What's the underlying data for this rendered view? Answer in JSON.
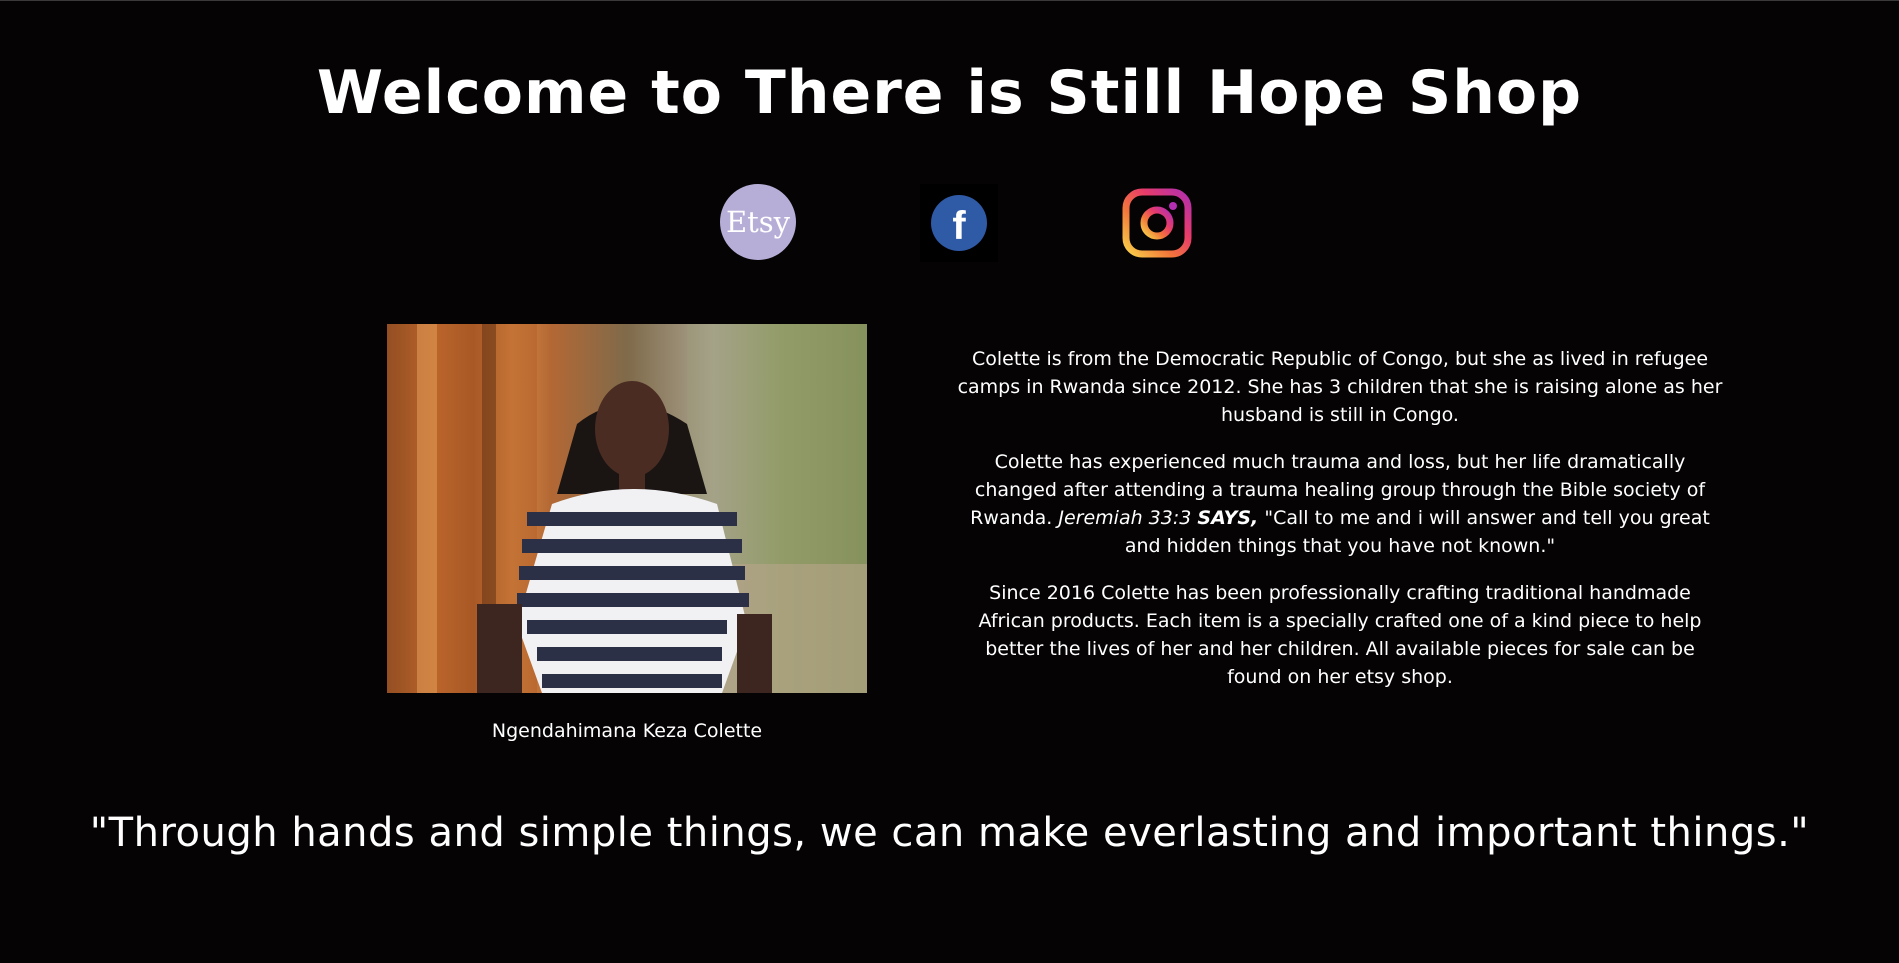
{
  "header": {
    "title": "Welcome to There is Still Hope Shop"
  },
  "social": {
    "etsy": {
      "label": "Etsy",
      "color": "#b7aed8"
    },
    "facebook": {
      "label": "f",
      "color": "#2f5aa6"
    },
    "instagram": {
      "gradient": [
        "#f9d24a",
        "#f2773a",
        "#e83c6a",
        "#b12fb0"
      ]
    }
  },
  "profile": {
    "caption": "Ngendahimana Keza Colette"
  },
  "bio": {
    "p1": "Colette is from the Democratic Republic of Congo, but she as lived in refugee camps in Rwanda since 2012. She has 3 children that she is raising alone as her husband is still in Congo.",
    "p2_before": "Colette has experienced much trauma and loss, but her life dramatically changed after attending a trauma healing group through the Bible society of Rwanda.",
    "p2_ref": "Jeremiah 33:3",
    "p2_says": "SAYS,",
    "p2_quote": "\"Call to me and i will answer and tell you great and hidden things that you have not known.\"",
    "p3": "Since 2016 Colette has been professionally crafting traditional handmade African products. Each item is a specially crafted one of a kind piece to help better the lives of her and her children. All available pieces for sale can be found on her etsy shop."
  },
  "motto": "\"Through hands and simple things, we can make everlasting and important things.\""
}
